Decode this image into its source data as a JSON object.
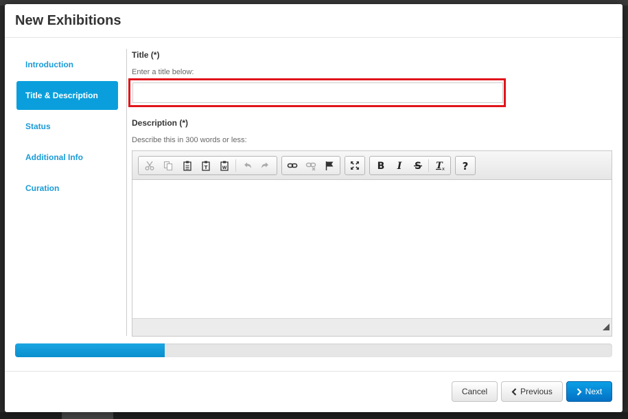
{
  "modal": {
    "title": "New Exhibitions"
  },
  "sidebar": {
    "items": [
      {
        "label": "Introduction",
        "active": false
      },
      {
        "label": "Title & Description",
        "active": true
      },
      {
        "label": "Status",
        "active": false
      },
      {
        "label": "Additional Info",
        "active": false
      },
      {
        "label": "Curation",
        "active": false
      }
    ]
  },
  "form": {
    "title_label": "Title (*)",
    "title_help": "Enter a title below:",
    "title_value": "",
    "description_label": "Description (*)",
    "description_help": "Describe this in 300 words or less:"
  },
  "editor": {
    "toolbar_icons": [
      "cut-icon",
      "copy-icon",
      "paste-icon",
      "paste-text-icon",
      "paste-word-icon",
      "undo-icon",
      "redo-icon",
      "link-icon",
      "unlink-icon",
      "anchor-flag-icon",
      "maximize-icon",
      "bold-icon",
      "italic-icon",
      "strikethrough-icon",
      "remove-format-icon",
      "help-icon"
    ]
  },
  "progress": {
    "fraction": 0.25
  },
  "footer": {
    "cancel_label": "Cancel",
    "previous_label": "Previous",
    "next_label": "Next"
  },
  "colors": {
    "accent": "#0a9fdc",
    "highlight_border": "#e0141b",
    "primary_button": "#0a83d8"
  }
}
